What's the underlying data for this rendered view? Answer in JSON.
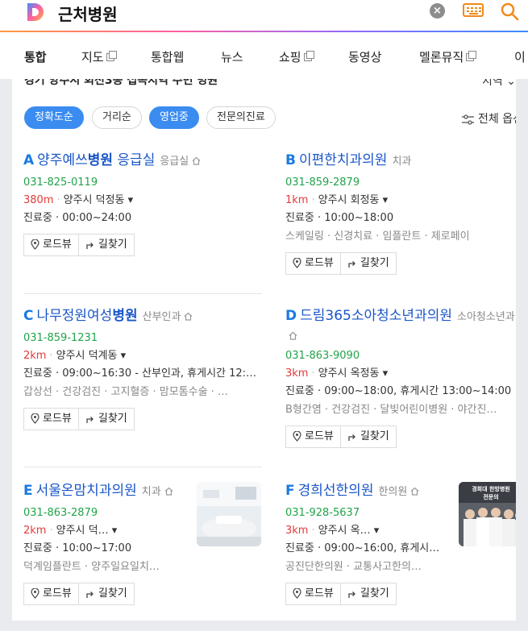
{
  "search": {
    "query": "근처병원",
    "clear": "×"
  },
  "tabs": [
    {
      "label": "통합",
      "active": true
    },
    {
      "label": "지도",
      "external": true
    },
    {
      "label": "통합웹"
    },
    {
      "label": "뉴스"
    },
    {
      "label": "쇼핑",
      "external": true
    },
    {
      "label": "동영상"
    },
    {
      "label": "멜론뮤직",
      "external": true
    },
    {
      "label": "이"
    }
  ],
  "location": {
    "text": "경기 양주시 회천3동 접속지역 주변 병원",
    "region": "지역"
  },
  "filters": {
    "chips": [
      {
        "label": "정확도순",
        "on": true
      },
      {
        "label": "거리순",
        "on": false
      },
      {
        "label": "영업중",
        "on": true
      },
      {
        "label": "전문의진료",
        "on": false
      }
    ],
    "all_options": "전체 옵션"
  },
  "buttons": {
    "roadview": "로드뷰",
    "directions": "길찾기"
  },
  "places": [
    {
      "letter": "A",
      "name_pre": "양주예쓰",
      "name_bold": "병원",
      "name_post": " 응급실",
      "category": "응급실",
      "phone": "031-825-0119",
      "distance": "380m",
      "area": "양주시 덕정동 ▾",
      "hours": "진료중 · 00:00~24:00",
      "tags": ""
    },
    {
      "letter": "B",
      "name_pre": "이편한치과의원",
      "name_bold": "",
      "name_post": "",
      "category": "치과",
      "phone": "031-859-2879",
      "distance": "1km",
      "area": "양주시 회정동 ▾",
      "hours": "진료중 · 10:00~18:00",
      "tags": "스케일링 · 신경치료 · 임플란트 · 제로페이"
    },
    {
      "letter": "C",
      "name_pre": "나무정원여성",
      "name_bold": "병원",
      "name_post": "",
      "category": "산부인과",
      "phone": "031-859-1231",
      "distance": "2km",
      "area": "양주시 덕계동 ▾",
      "hours": "진료중 · 09:00~16:30 - 산부인과, 휴게시간 12:…",
      "tags": "갑상선 · 건강검진 · 고지혈증 · 맘모톰수술 · …"
    },
    {
      "letter": "D",
      "name_pre": "드림365소아청소년과의원",
      "name_bold": "",
      "name_post": "",
      "category": "소아청소년과",
      "phone": "031-863-9090",
      "distance": "3km",
      "area": "양주시 옥정동 ▾",
      "hours": "진료중 · 09:00~18:00, 휴게시간 13:00~14:00",
      "tags": "B형간염 · 건강검진 · 달빛어린이병원 · 야간진…"
    },
    {
      "letter": "E",
      "name_pre": "서울온맘치과의원",
      "name_bold": "",
      "name_post": "",
      "category": "치과",
      "phone": "031-863-2879",
      "distance": "2km",
      "area": "양주시 덕… ▾",
      "hours": "진료중 · 10:00~17:00",
      "tags": "덕계임플란트 · 양주일요일치…"
    },
    {
      "letter": "F",
      "name_pre": "경희선한의원",
      "name_bold": "",
      "name_post": "",
      "category": "한의원",
      "phone": "031-928-5637",
      "distance": "3km",
      "area": "양주시 옥… ▾",
      "hours": "진료중 · 09:00~16:00, 휴게시…",
      "tags": "공진단한의원 · 교통사고한의…",
      "thumb_text": "경희대 한방병원 전문의"
    }
  ]
}
